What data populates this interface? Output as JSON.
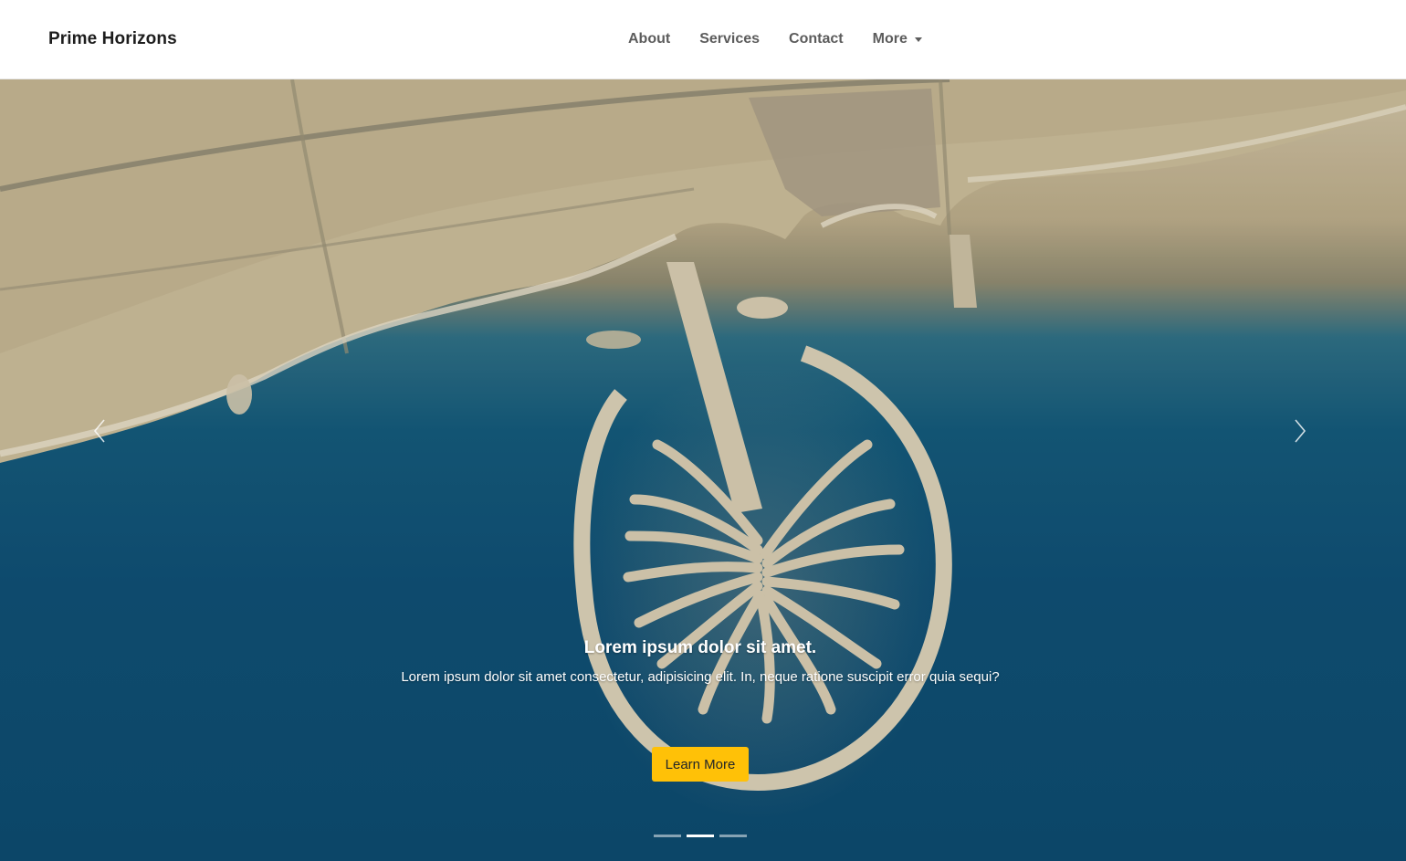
{
  "brand": "Prime Horizons",
  "nav": {
    "links": [
      "About",
      "Services",
      "Contact"
    ],
    "more_label": "More"
  },
  "hero": {
    "caption_title": "Lorem ipsum dolor sit amet.",
    "caption_text": "Lorem ipsum dolor sit amet consectetur, adipisicing elit. In, neque ratione suscipit error quia sequi?",
    "cta_label": "Learn More",
    "prev_icon": "chevron-left-icon",
    "next_icon": "chevron-right-icon",
    "slide_count": 3,
    "active_slide": 2
  },
  "colors": {
    "cta": "#ffc107",
    "water": "#0f4f73",
    "land": "#cfc2a4"
  }
}
